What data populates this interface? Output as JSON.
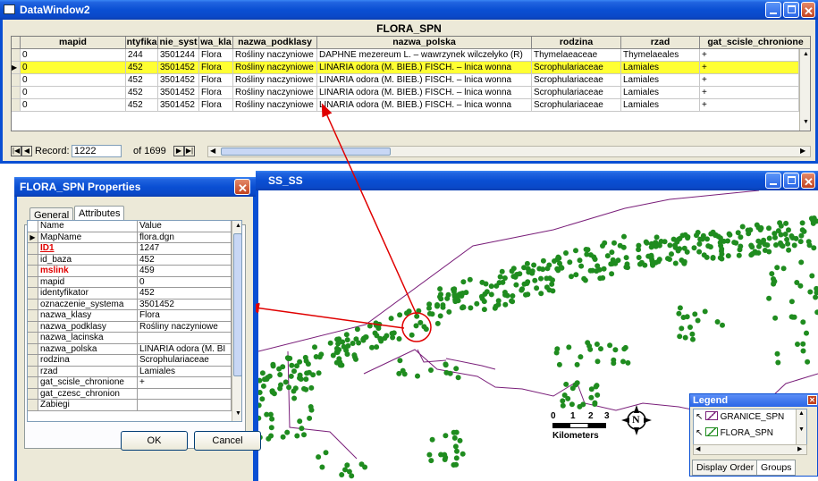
{
  "datawindow": {
    "title": "DataWindow2",
    "grid_title": "FLORA_SPN",
    "columns": [
      "mapid",
      "ntyfika",
      "nie_syst",
      "wa_kla",
      "nazwa_podklasy",
      "nazwa_polska",
      "rodzina",
      "rzad",
      "gat_scisle_chronione"
    ],
    "rows": [
      [
        "0",
        "244",
        "3501244",
        "Flora",
        "Rośliny naczyniowe",
        "DAPHNE mezereum L. – wawrzynek wilczełyko (R)",
        "Thymelaeaceae",
        "Thymelaeales",
        "+"
      ],
      [
        "0",
        "452",
        "3501452",
        "Flora",
        "Rośliny naczyniowe",
        "LINARIA odora (M. BIEB.) FISCH. – lnica wonna",
        "Scrophulariaceae",
        "Lamiales",
        "+"
      ],
      [
        "0",
        "452",
        "3501452",
        "Flora",
        "Rośliny naczyniowe",
        "LINARIA odora (M. BIEB.) FISCH. – lnica wonna",
        "Scrophulariaceae",
        "Lamiales",
        "+"
      ],
      [
        "0",
        "452",
        "3501452",
        "Flora",
        "Rośliny naczyniowe",
        "LINARIA odora (M. BIEB.) FISCH. – lnica wonna",
        "Scrophulariaceae",
        "Lamiales",
        "+"
      ],
      [
        "0",
        "452",
        "3501452",
        "Flora",
        "Rośliny naczyniowe",
        "LINARIA odora (M. BIEB.) FISCH. – lnica wonna",
        "Scrophulariaceae",
        "Lamiales",
        "+"
      ]
    ],
    "selected_row": 1,
    "record_label": "Record:",
    "record_value": "1222",
    "record_total": "of 1699"
  },
  "mapwin": {
    "title": "SS_SS"
  },
  "props": {
    "title": "FLORA_SPN Properties",
    "tabs": [
      "General",
      "Attributes"
    ],
    "active_tab": "Attributes",
    "header": [
      "Name",
      "Value"
    ],
    "rows": [
      {
        "name": "MapName",
        "value": "flora.dgn",
        "style": ""
      },
      {
        "name": "ID1",
        "value": "1247",
        "style": "red"
      },
      {
        "name": "id_baza",
        "value": "452",
        "style": ""
      },
      {
        "name": "mslink",
        "value": "459",
        "style": "redplain"
      },
      {
        "name": "mapid",
        "value": "0",
        "style": ""
      },
      {
        "name": "identyfikator",
        "value": "452",
        "style": ""
      },
      {
        "name": "oznaczenie_systema",
        "value": "3501452",
        "style": ""
      },
      {
        "name": "nazwa_klasy",
        "value": "Flora",
        "style": ""
      },
      {
        "name": "nazwa_podklasy",
        "value": "Rośliny naczyniowe",
        "style": ""
      },
      {
        "name": "nazwa_lacinska",
        "value": "",
        "style": ""
      },
      {
        "name": "nazwa_polska",
        "value": "LINARIA odora (M. BI",
        "style": ""
      },
      {
        "name": "rodzina",
        "value": "Scrophulariaceae",
        "style": ""
      },
      {
        "name": "rzad",
        "value": "Lamiales",
        "style": ""
      },
      {
        "name": "gat_scisle_chronione",
        "value": "+",
        "style": ""
      },
      {
        "name": "gat_czesc_chronion",
        "value": "",
        "style": ""
      },
      {
        "name": "Zabiegi",
        "value": "",
        "style": ""
      }
    ],
    "ok_label": "OK",
    "cancel_label": "Cancel"
  },
  "legend": {
    "title": "Legend",
    "layers": [
      "GRANICE_SPN",
      "FLORA_SPN"
    ],
    "tabs": [
      "Display Order",
      "Groups"
    ]
  },
  "scalebar": {
    "ticks": [
      "0",
      "1",
      "2",
      "3"
    ],
    "unit": "Kilometers"
  },
  "north_arrow": {
    "label": "N"
  },
  "colors": {
    "xp_blue": "#0a4fd3",
    "selection": "#ffff33",
    "points": "#1f8c1f",
    "boundary": "#7a1f7a",
    "arrows": "#e00000"
  }
}
